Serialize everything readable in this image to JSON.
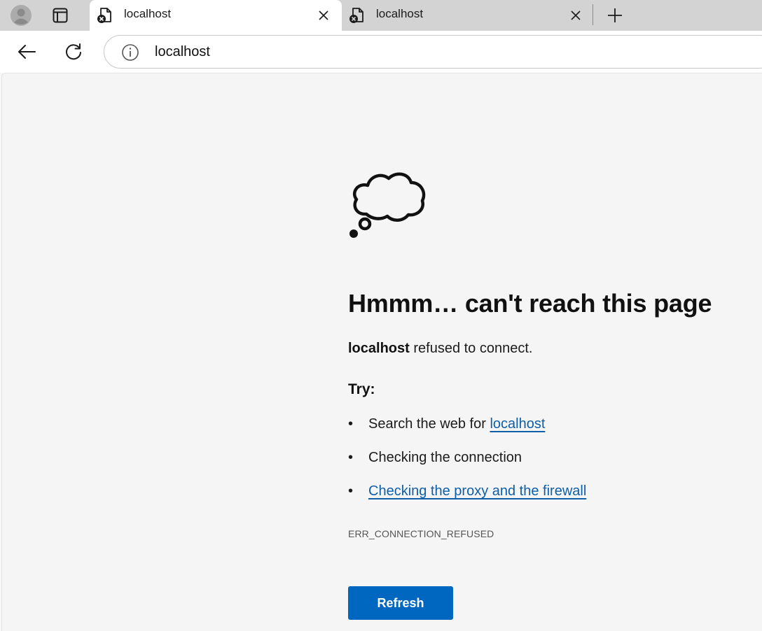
{
  "tabs": [
    {
      "title": "localhost",
      "favicon": "page-error-icon",
      "active": true
    },
    {
      "title": "localhost",
      "favicon": "page-error-icon",
      "active": false
    }
  ],
  "toolbar": {
    "address": "localhost",
    "icons": [
      "back-arrow-icon",
      "reload-icon",
      "site-info-icon"
    ]
  },
  "error_page": {
    "heading": "Hmmm… can't reach this page",
    "host": "localhost",
    "message": "refused to connect.",
    "try_label": "Try:",
    "suggestion_1_prefix": "Search the web for ",
    "suggestion_1_link": "localhost",
    "suggestion_2": "Checking the connection",
    "suggestion_3_link": "Checking the proxy and the firewall",
    "error_code": "ERR_CONNECTION_REFUSED",
    "refresh_label": "Refresh",
    "bullet": "•"
  },
  "colors": {
    "accent": "#0067c0",
    "link": "#0f5ea8",
    "tabstrip": "#d3d3d3",
    "page_bg": "#f5f5f5"
  }
}
